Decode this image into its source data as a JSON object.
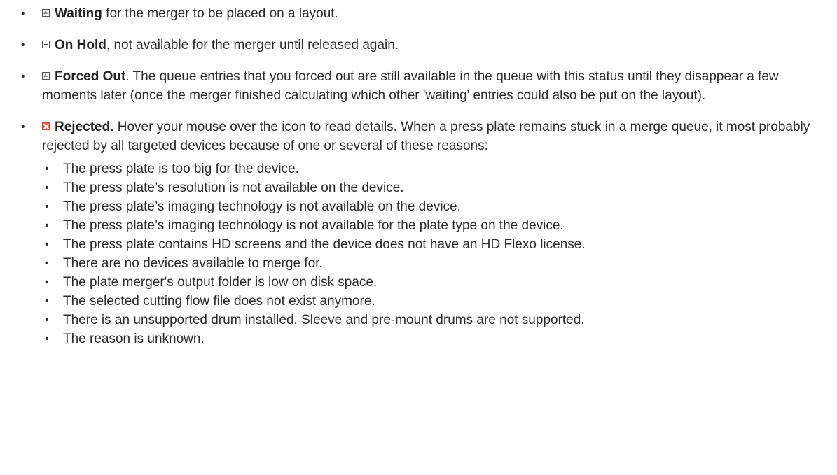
{
  "bullet_char": "•",
  "items": [
    {
      "icon": "waiting-icon",
      "term": "Waiting",
      "text": " for the merger to be placed on a layout."
    },
    {
      "icon": "on-hold-icon",
      "term": "On Hold",
      "text": ", not available for the merger until released again."
    },
    {
      "icon": "forced-out-icon",
      "term": "Forced Out",
      "text": ". The queue entries that you forced out are still available in the queue with this status until they disappear a few moments later (once the merger finished calculating which other 'waiting' entries could also be put on the layout)."
    },
    {
      "icon": "rejected-icon",
      "term": "Rejected",
      "text": ". Hover your mouse over the icon to read details. When a press plate remains stuck in a merge queue, it most probably rejected by all targeted devices because of one or several of these reasons:"
    }
  ],
  "reasons": [
    "The press plate is too big for the device.",
    "The press plate’s resolution is not available on the device.",
    "The press plate’s imaging technology is not available on the device.",
    "The press plate’s imaging technology is not available for the plate type on the device.",
    "The press plate contains HD screens and the device does not have an HD Flexo license.",
    "There are no devices available to merge for.",
    "The plate merger's output folder is low on disk space.",
    "The selected cutting flow file does not exist anymore.",
    "There is an unsupported drum installed. Sleeve and pre-mount drums are not supported.",
    "The reason is unknown."
  ],
  "colors": {
    "text": "#2b2b2b",
    "rejected_icon": "#e8664f"
  }
}
